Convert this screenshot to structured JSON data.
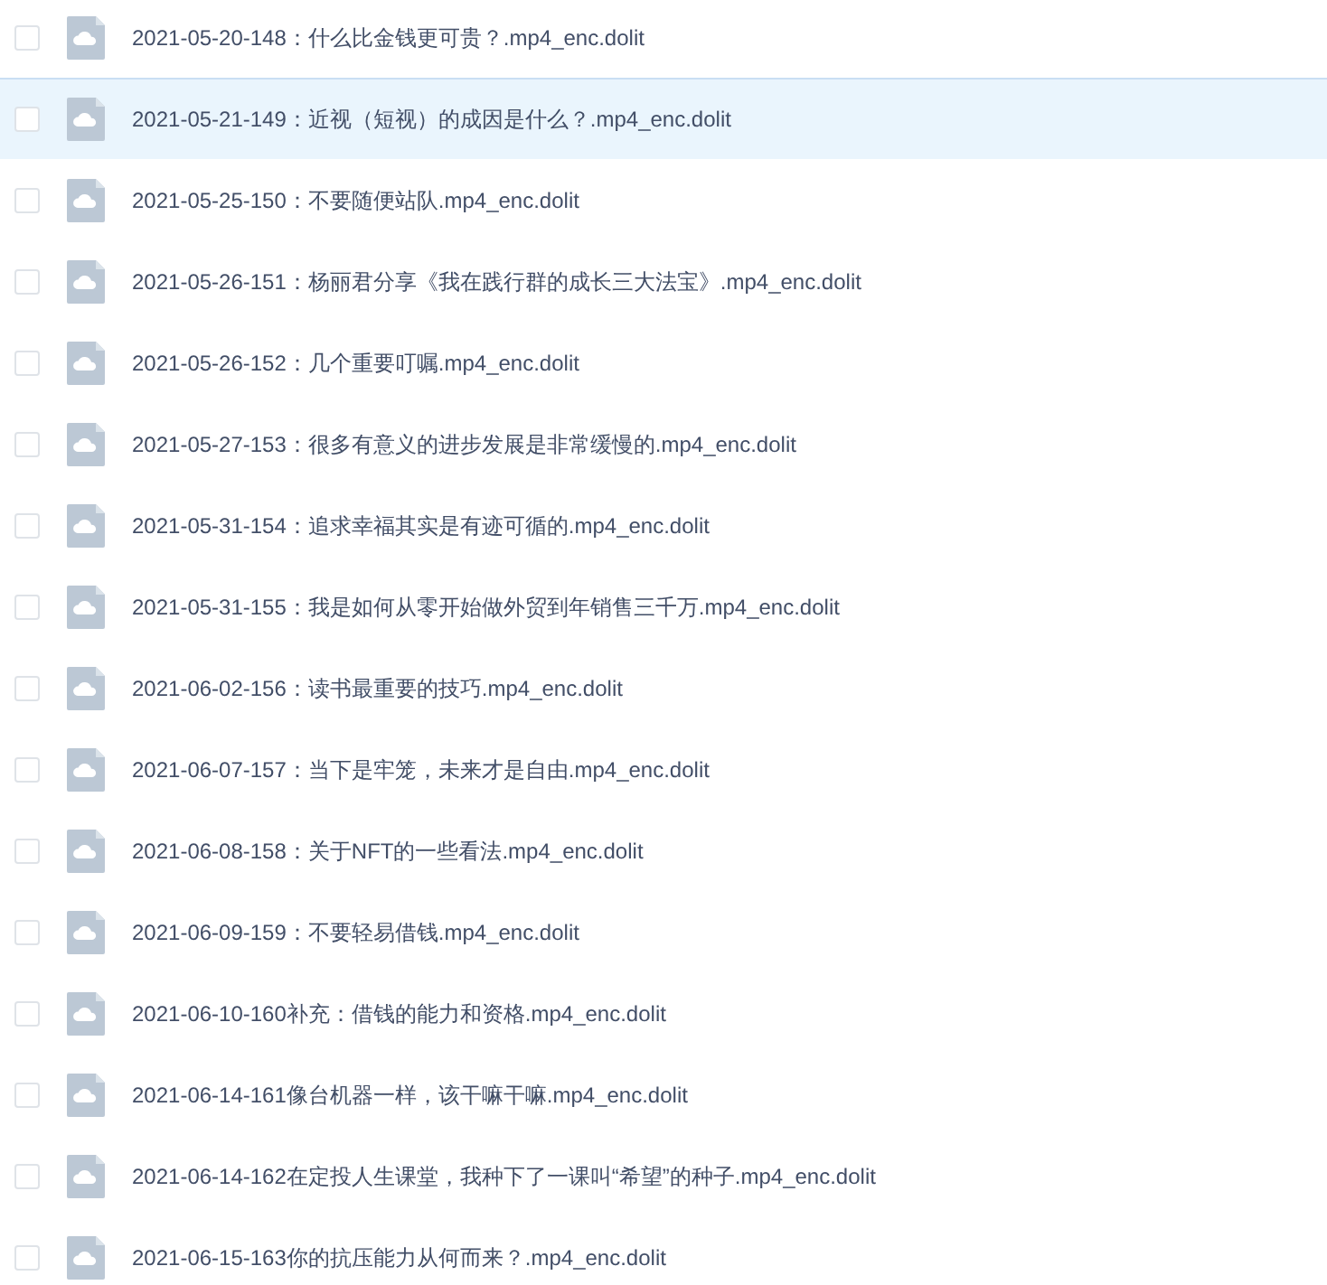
{
  "files": [
    {
      "name": "2021-05-20-148：什么比金钱更可贵？.mp4_enc.dolit",
      "checked": false,
      "highlighted": false
    },
    {
      "name": "2021-05-21-149：近视（短视）的成因是什么？.mp4_enc.dolit",
      "checked": false,
      "highlighted": true
    },
    {
      "name": "2021-05-25-150：不要随便站队.mp4_enc.dolit",
      "checked": false,
      "highlighted": false
    },
    {
      "name": "2021-05-26-151：杨丽君分享《我在践行群的成长三大法宝》.mp4_enc.dolit",
      "checked": false,
      "highlighted": false
    },
    {
      "name": "2021-05-26-152：几个重要叮嘱.mp4_enc.dolit",
      "checked": false,
      "highlighted": false
    },
    {
      "name": "2021-05-27-153：很多有意义的进步发展是非常缓慢的.mp4_enc.dolit",
      "checked": false,
      "highlighted": false
    },
    {
      "name": "2021-05-31-154：追求幸福其实是有迹可循的.mp4_enc.dolit",
      "checked": false,
      "highlighted": false
    },
    {
      "name": "2021-05-31-155：我是如何从零开始做外贸到年销售三千万.mp4_enc.dolit",
      "checked": false,
      "highlighted": false
    },
    {
      "name": "2021-06-02-156：读书最重要的技巧.mp4_enc.dolit",
      "checked": false,
      "highlighted": false
    },
    {
      "name": "2021-06-07-157：当下是牢笼，未来才是自由.mp4_enc.dolit",
      "checked": false,
      "highlighted": false
    },
    {
      "name": "2021-06-08-158：关于NFT的一些看法.mp4_enc.dolit",
      "checked": false,
      "highlighted": false
    },
    {
      "name": "2021-06-09-159：不要轻易借钱.mp4_enc.dolit",
      "checked": false,
      "highlighted": false
    },
    {
      "name": "2021-06-10-160补充：借钱的能力和资格.mp4_enc.dolit",
      "checked": false,
      "highlighted": false
    },
    {
      "name": "2021-06-14-161像台机器一样，该干嘛干嘛.mp4_enc.dolit",
      "checked": false,
      "highlighted": false
    },
    {
      "name": "2021-06-14-162在定投人生课堂，我种下了一课叫“希望”的种子.mp4_enc.dolit",
      "checked": false,
      "highlighted": false
    },
    {
      "name": "2021-06-15-163你的抗压能力从何而来？.mp4_enc.dolit",
      "checked": false,
      "highlighted": false
    }
  ]
}
